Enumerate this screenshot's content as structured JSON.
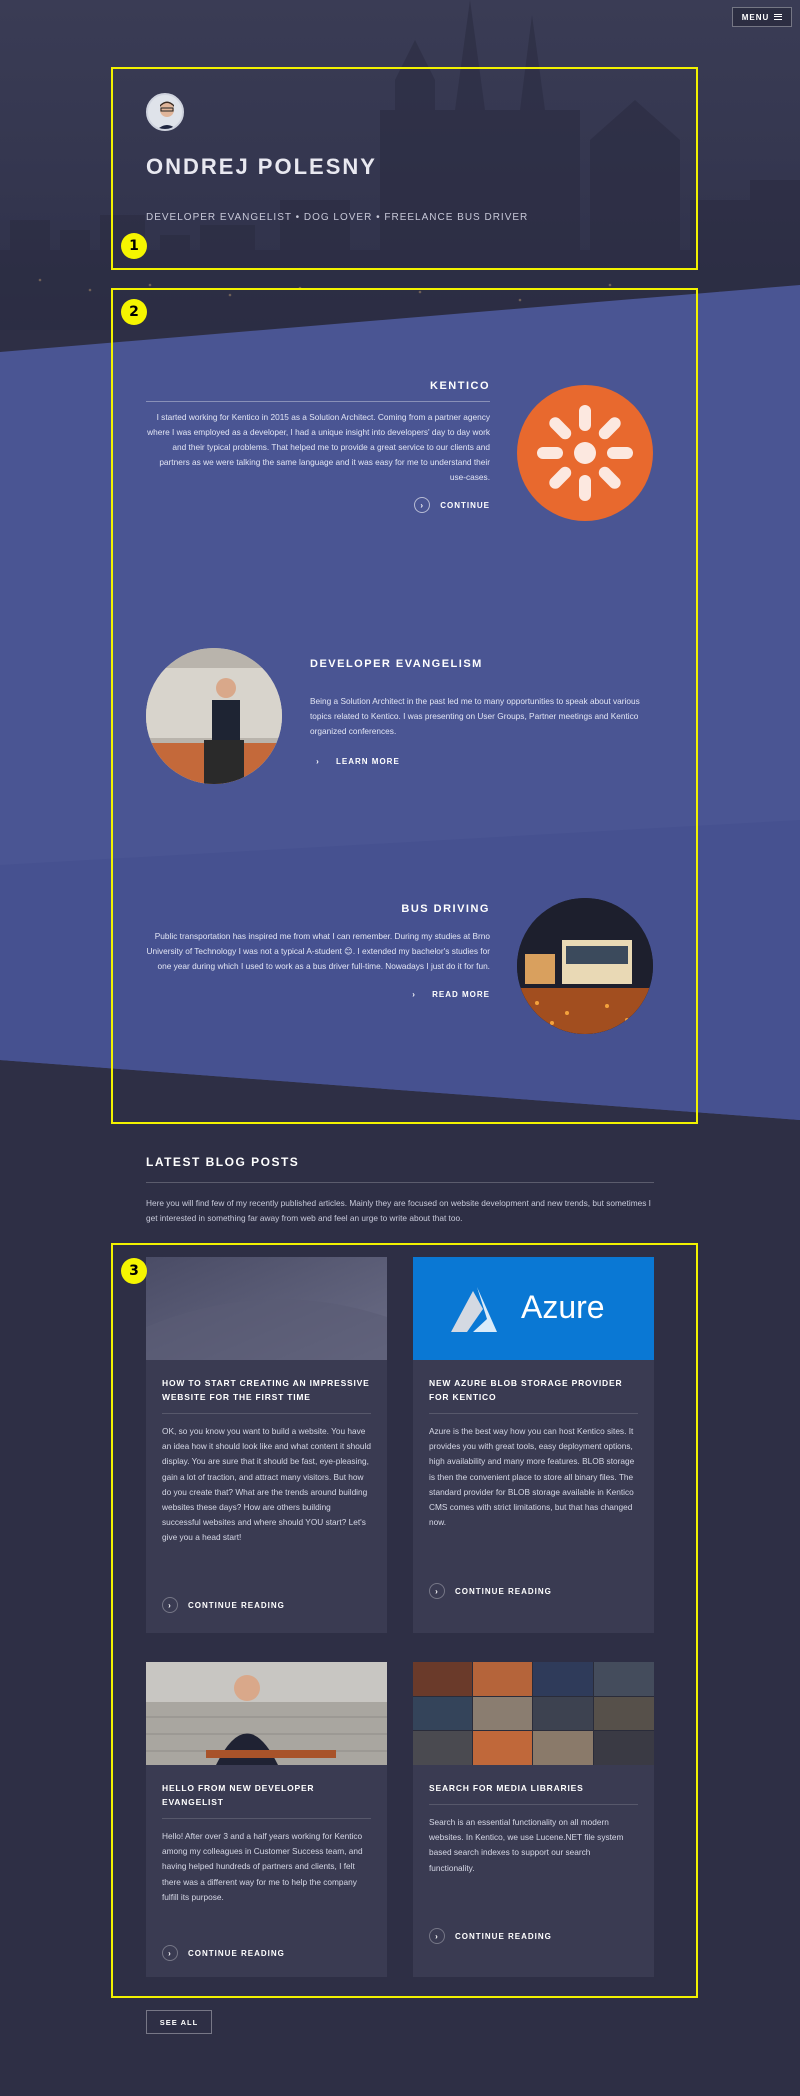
{
  "header": {
    "menu_label": "MENU"
  },
  "hero": {
    "name": "ONDREJ POLESNY",
    "tagline": "DEVELOPER EVANGELIST • DOG LOVER • FREELANCE BUS DRIVER"
  },
  "features": [
    {
      "title": "KENTICO",
      "text": "I started working for Kentico in 2015 as a Solution Architect. Coming from a partner agency where I was employed as a developer, I had a unique insight into developers' day to day work and their typical problems. That helped me to provide a great service to our clients and partners as we were talking the same language and it was easy for me to understand their use-cases.",
      "link": "CONTINUE"
    },
    {
      "title": "DEVELOPER EVANGELISM",
      "text": "Being a Solution Architect in the past led me to many opportunities to speak about various topics related to Kentico. I was presenting on User Groups, Partner meetings and Kentico organized conferences.",
      "link": "LEARN MORE"
    },
    {
      "title": "BUS DRIVING",
      "text": "Public transportation has inspired me from what I can remember. During my studies at Brno University of Technology I was not a typical A-student 😊. I extended my bachelor's studies for one year during which I used to work as a bus driver full-time. Nowadays I just do it for fun.",
      "link": "READ MORE"
    }
  ],
  "blog": {
    "heading": "LATEST BLOG POSTS",
    "intro": "Here you will find few of my recently published articles. Mainly they are focused on website development and new trends, but sometimes I get interested in something far away from web and feel an urge to write about that too.",
    "posts": [
      {
        "title": "HOW TO START CREATING AN IMPRESSIVE WEBSITE FOR THE FIRST TIME",
        "text": "OK, so you know you want to build a website. You have an idea how it should look like and what content it should display. You are sure that it should be fast, eye-pleasing, gain a lot of traction, and attract many visitors. But how do you create that? What are the trends around building websites these days? How are others building successful websites and where should YOU start? Let's give you a head start!",
        "link": "CONTINUE READING"
      },
      {
        "title": "NEW AZURE BLOB STORAGE PROVIDER FOR KENTICO",
        "text": "Azure is the best way how you can host Kentico sites. It provides you with great tools, easy deployment options, high availability and many more features. BLOB storage is then the convenient place to store all binary files. The standard provider for BLOB storage available in Kentico CMS comes with strict limitations, but that has changed now.",
        "link": "CONTINUE READING",
        "image_text": "Azure"
      },
      {
        "title": "HELLO FROM NEW DEVELOPER EVANGELIST",
        "text": "Hello! After over 3 and a half years working for Kentico among my colleagues in Customer Success team, and having helped hundreds of partners and clients, I felt there was a different way for me to help the company fulfill its purpose.",
        "link": "CONTINUE READING"
      },
      {
        "title": "SEARCH FOR MEDIA LIBRARIES",
        "text": "Search is an essential functionality on all modern websites. In Kentico, we use Lucene.NET file system based search indexes to support our search functionality.",
        "link": "CONTINUE READING"
      }
    ],
    "see_all": "SEE ALL"
  },
  "annotations": [
    "1",
    "2",
    "3"
  ],
  "colors": {
    "background": "#2e2f45",
    "band": "#4a5593",
    "card": "#3a3b52",
    "kentico_orange": "#e8692e",
    "azure_blue": "#0a78d4",
    "annotation": "#f2f200"
  }
}
